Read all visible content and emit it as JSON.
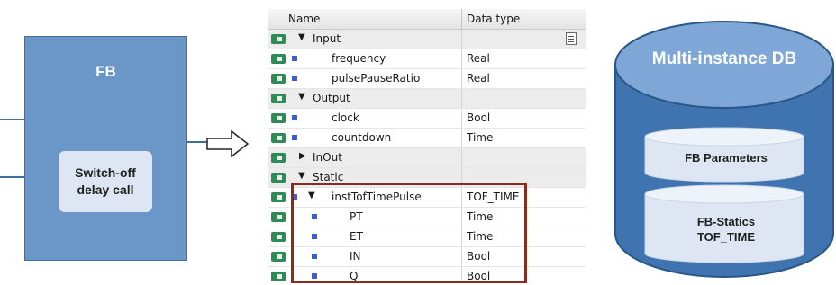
{
  "fb": {
    "title": "FB",
    "call_line1": "Switch-off",
    "call_line2": "delay call"
  },
  "table": {
    "col_name": "Name",
    "col_type": "Data type",
    "rows": [
      {
        "name": "Input",
        "type": ""
      },
      {
        "name": "frequency",
        "type": "Real"
      },
      {
        "name": "pulsePauseRatio",
        "type": "Real"
      },
      {
        "name": "Output",
        "type": ""
      },
      {
        "name": "clock",
        "type": "Bool"
      },
      {
        "name": "countdown",
        "type": "Time"
      },
      {
        "name": "InOut",
        "type": ""
      },
      {
        "name": "Static",
        "type": ""
      },
      {
        "name": "instTofTimePulse",
        "type": "TOF_TIME"
      },
      {
        "name": "PT",
        "type": "Time"
      },
      {
        "name": "ET",
        "type": "Time"
      },
      {
        "name": "IN",
        "type": "Bool"
      },
      {
        "name": "Q",
        "type": "Bool"
      }
    ]
  },
  "db": {
    "title": "Multi-instance DB",
    "parameters": "FB Parameters",
    "statics_line1": "FB-Statics",
    "statics_line2": "TOF_TIME"
  },
  "colors": {
    "fb_fill": "#6a96c8",
    "cylinder_fill": "#3f74b0",
    "cylinder_top": "#7ea6d6",
    "highlight_border": "#8b2a1d",
    "tag_icon": "#2e8b57"
  }
}
